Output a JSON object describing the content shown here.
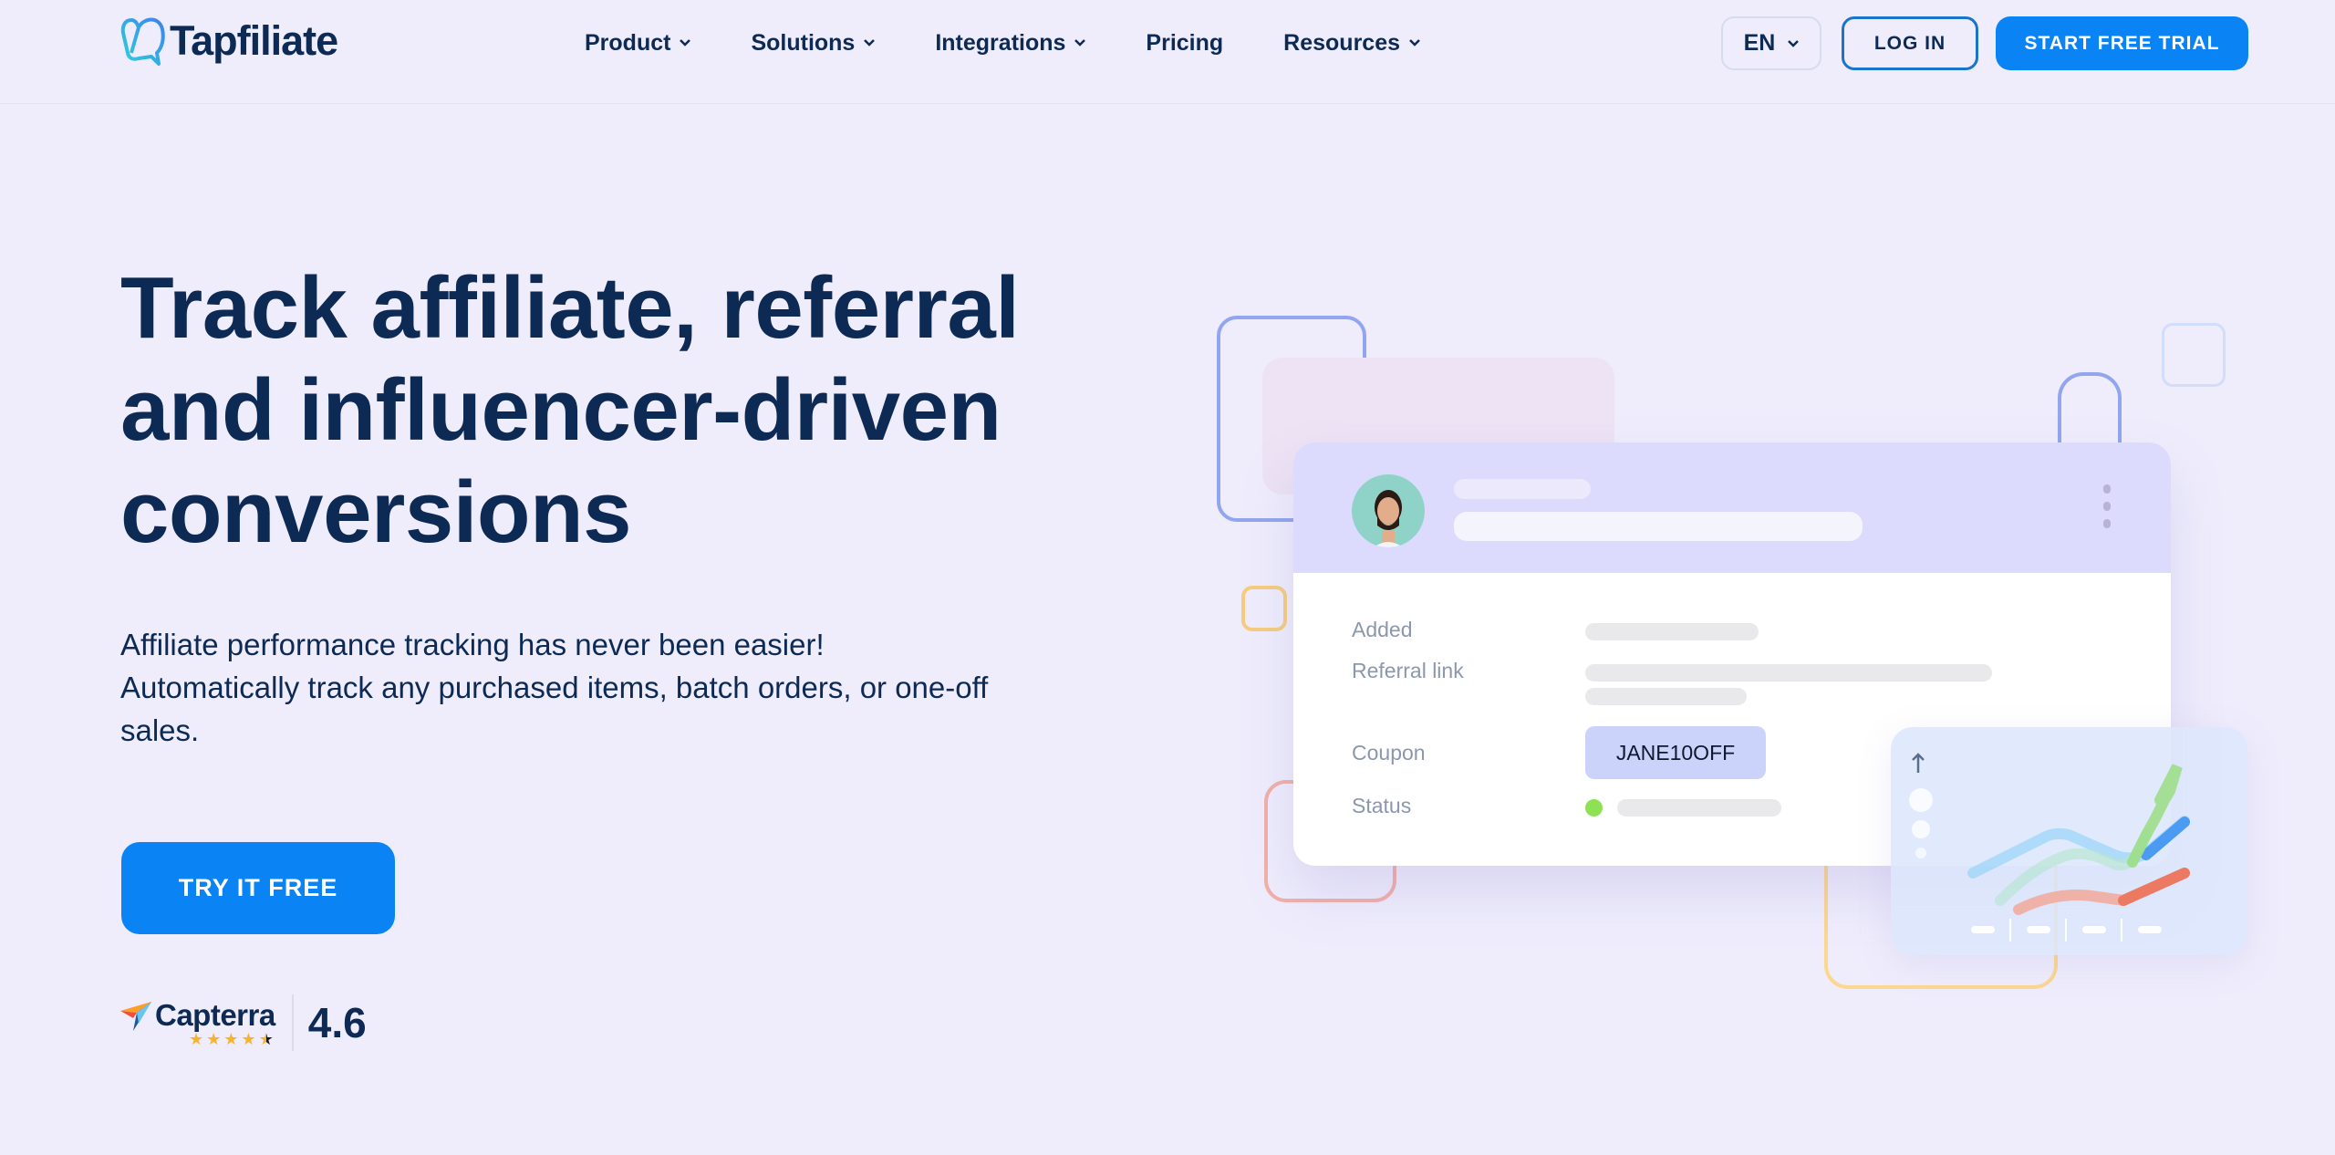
{
  "header": {
    "logo_text": "Tapfiliate",
    "nav": [
      {
        "label": "Product",
        "has_dropdown": true
      },
      {
        "label": "Solutions",
        "has_dropdown": true
      },
      {
        "label": "Integrations",
        "has_dropdown": true
      },
      {
        "label": "Pricing",
        "has_dropdown": false
      },
      {
        "label": "Resources",
        "has_dropdown": true
      }
    ],
    "language": "EN",
    "login_label": "LOG IN",
    "trial_label": "START FREE TRIAL"
  },
  "hero": {
    "headline_lines": [
      "Track affiliate, referral",
      "and influencer-driven",
      "conversions"
    ],
    "sub_lines": [
      "Affiliate performance tracking has never been easier!",
      "Automatically track any purchased items, batch orders, or one-off",
      "sales."
    ],
    "cta_label": "TRY IT FREE",
    "rating": {
      "brand": "Capterra",
      "score": "4.6",
      "stars": 4.5
    }
  },
  "illustration": {
    "rows": [
      {
        "label": "Added"
      },
      {
        "label": "Referral link"
      },
      {
        "label": "Coupon",
        "value": "JANE10OFF"
      },
      {
        "label": "Status"
      }
    ],
    "colors": {
      "accent": "#0a84f5",
      "status_active": "#8ee152",
      "coupon_bg": "#cbd3fb",
      "header_bg": "#dcdafd"
    }
  }
}
